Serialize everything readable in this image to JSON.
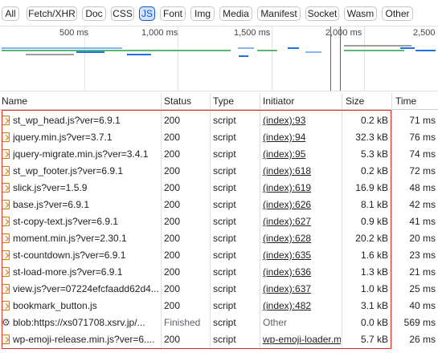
{
  "filters": [
    "All",
    "Fetch/XHR",
    "Doc",
    "CSS",
    "JS",
    "Font",
    "Img",
    "Media",
    "Manifest",
    "Socket",
    "Wasm",
    "Other"
  ],
  "active_filter": "JS",
  "timeline": {
    "ticks": [
      "500 ms",
      "1,000 ms",
      "1,500 ms",
      "2,000 ms",
      "2,500 ms"
    ]
  },
  "columns": {
    "name": "Name",
    "status": "Status",
    "type": "Type",
    "initiator": "Initiator",
    "size": "Size",
    "time": "Time"
  },
  "rows": [
    {
      "name": "st_wp_head.js?ver=6.9.1",
      "status": "200",
      "type": "script",
      "initiator": "(index):93",
      "size": "0.2 kB",
      "time": "71 ms"
    },
    {
      "name": "jquery.min.js?ver=3.7.1",
      "status": "200",
      "type": "script",
      "initiator": "(index):94",
      "size": "32.3 kB",
      "time": "76 ms"
    },
    {
      "name": "jquery-migrate.min.js?ver=3.4.1",
      "status": "200",
      "type": "script",
      "initiator": "(index):95",
      "size": "5.3 kB",
      "time": "74 ms"
    },
    {
      "name": "st_wp_footer.js?ver=6.9.1",
      "status": "200",
      "type": "script",
      "initiator": "(index):618",
      "size": "0.2 kB",
      "time": "72 ms"
    },
    {
      "name": "slick.js?ver=1.5.9",
      "status": "200",
      "type": "script",
      "initiator": "(index):619",
      "size": "16.9 kB",
      "time": "48 ms"
    },
    {
      "name": "base.js?ver=6.9.1",
      "status": "200",
      "type": "script",
      "initiator": "(index):626",
      "size": "8.1 kB",
      "time": "42 ms"
    },
    {
      "name": "st-copy-text.js?ver=6.9.1",
      "status": "200",
      "type": "script",
      "initiator": "(index):627",
      "size": "0.9 kB",
      "time": "41 ms"
    },
    {
      "name": "moment.min.js?ver=2.30.1",
      "status": "200",
      "type": "script",
      "initiator": "(index):628",
      "size": "20.2 kB",
      "time": "20 ms"
    },
    {
      "name": "st-countdown.js?ver=6.9.1",
      "status": "200",
      "type": "script",
      "initiator": "(index):635",
      "size": "1.6 kB",
      "time": "23 ms"
    },
    {
      "name": "st-load-more.js?ver=6.9.1",
      "status": "200",
      "type": "script",
      "initiator": "(index):636",
      "size": "1.3 kB",
      "time": "21 ms"
    },
    {
      "name": "view.js?ver=07224efcfaadd62d4...",
      "status": "200",
      "type": "script",
      "initiator": "(index):637",
      "size": "1.0 kB",
      "time": "25 ms"
    },
    {
      "name": "bookmark_button.js",
      "status": "200",
      "type": "script",
      "initiator": "(index):482",
      "size": "3.1 kB",
      "time": "40 ms"
    },
    {
      "name": "blob:https://xs071708.xsrv.jp/...",
      "status": "Finished",
      "type": "script",
      "initiator": "Other",
      "size": "0.0 kB",
      "time": "569 ms"
    },
    {
      "name": "wp-emoji-release.min.js?ver=6....",
      "status": "200",
      "type": "script",
      "initiator": "wp-emoji-loader.m",
      "size": "5.7 kB",
      "time": "26 ms"
    }
  ]
}
